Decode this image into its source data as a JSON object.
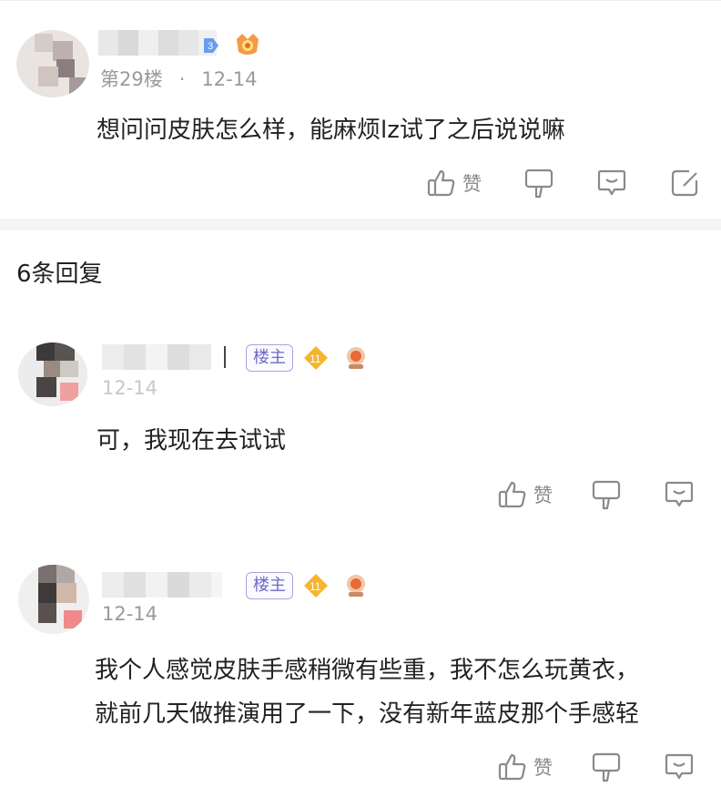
{
  "post": {
    "floor": "第29楼",
    "separator": "·",
    "date": "12-14",
    "text": "想问问皮肤怎么样，能麻烦lz试了之后说说嘛",
    "like_label": "赞"
  },
  "replies_header": "6条回复",
  "replies": [
    {
      "badge": "楼主",
      "level": "11",
      "date": "12-14",
      "text": [
        "可，我现在去试试"
      ],
      "like_label": "赞"
    },
    {
      "badge": "楼主",
      "level": "11",
      "date": "12-14",
      "text": [
        "我个人感觉皮肤手感稍微有些重，我不怎么玩黄衣，",
        "就前几天做推演用了一下，没有新年蓝皮那个手感轻"
      ],
      "like_label": "赞"
    }
  ],
  "colors": {
    "accent": "#6e68c8",
    "level_badge": "#f5b52e",
    "muted": "#9a9a9a"
  },
  "icons": [
    "like-icon",
    "dislike-icon",
    "comment-icon",
    "share-icon",
    "level-badge-icon",
    "medal-icon"
  ]
}
